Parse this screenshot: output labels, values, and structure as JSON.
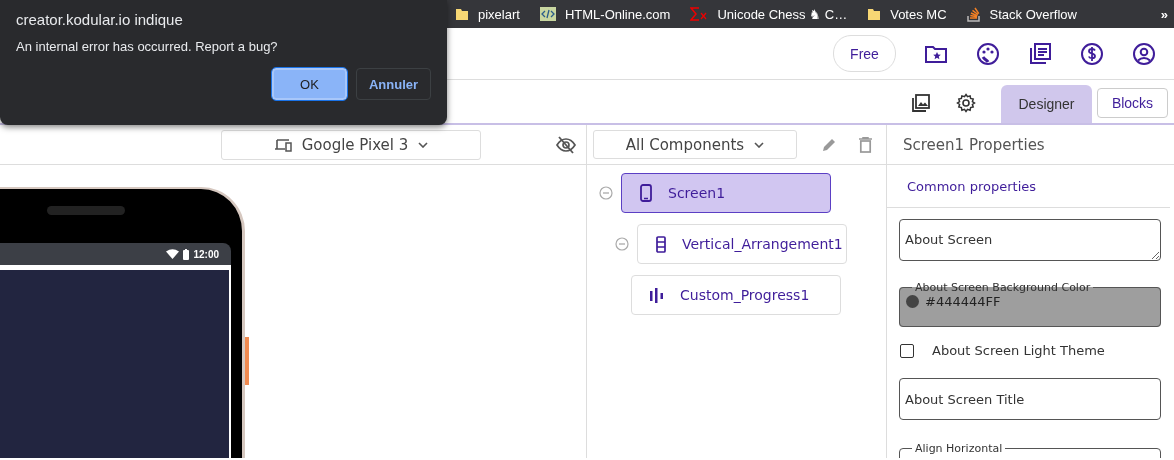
{
  "dialog": {
    "title": "creator.kodular.io indique",
    "message": "An internal error has occurred. Report a bug?",
    "buttons": [
      {
        "label": "OK",
        "selected": true
      },
      {
        "label": "Annuler",
        "selected": false
      }
    ]
  },
  "bookmarks": [
    {
      "label": "pixelart",
      "kind": "folder"
    },
    {
      "label": "HTML-Online.com",
      "kind": "code"
    },
    {
      "label": "Unicode Chess ♞ C…",
      "kind": "sigma"
    },
    {
      "label": "Votes MC",
      "kind": "folder"
    },
    {
      "label": "Stack Overflow",
      "kind": "stack"
    }
  ],
  "bookmarks_more": "»",
  "header": {
    "plan": "Free"
  },
  "toolbar": {
    "tabs": [
      {
        "label": "Designer",
        "selected": true
      },
      {
        "label": "Blocks",
        "selected": false
      }
    ]
  },
  "viewer": {
    "device": "Google Pixel 3",
    "phone": {
      "time": "12:00"
    }
  },
  "components": {
    "filter": "All Components",
    "tree": [
      {
        "name": "Screen1",
        "kind": "screen",
        "selected": true,
        "expanded": true,
        "children": [
          {
            "name": "Vertical_Arrangement1",
            "kind": "vertical",
            "selected": false,
            "expanded": true,
            "children": [
              {
                "name": "Custom_Progress1",
                "kind": "progress",
                "selected": false
              }
            ]
          }
        ]
      }
    ]
  },
  "properties": {
    "title": "Screen1 Properties",
    "section": "Common properties",
    "fields": [
      {
        "kind": "textarea",
        "value": "About Screen"
      },
      {
        "kind": "color",
        "label": "About Screen Background Color",
        "value": "#444444FF"
      },
      {
        "kind": "checkbox",
        "label": "About Screen Light Theme",
        "checked": false
      },
      {
        "kind": "text",
        "value": "About Screen Title"
      },
      {
        "kind": "select",
        "label": "Align Horizontal"
      }
    ]
  }
}
